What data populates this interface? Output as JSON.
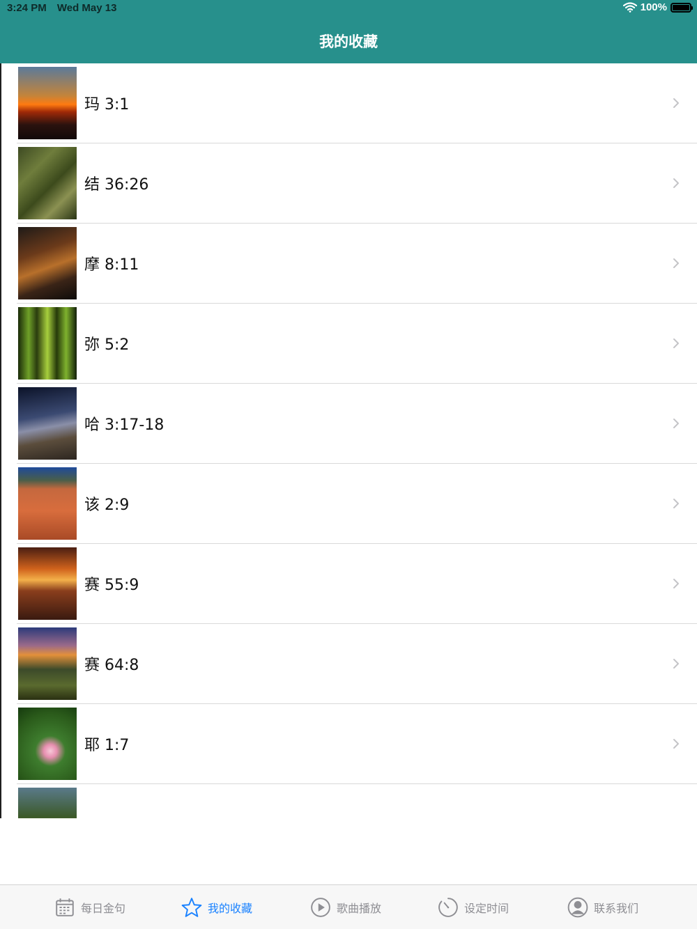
{
  "status_bar": {
    "time": "3:24 PM",
    "date": "Wed May 13",
    "battery": "100%"
  },
  "nav": {
    "title": "我的收藏"
  },
  "favorites": [
    {
      "label": "玛 3:1",
      "image": "sunset-over-clouds"
    },
    {
      "label": "结 36:26",
      "image": "mossy-forest-trees"
    },
    {
      "label": "摩 8:11",
      "image": "golden-gate-bridge"
    },
    {
      "label": "弥 5:2",
      "image": "green-bamboo"
    },
    {
      "label": "哈 3:17-18",
      "image": "milky-way-night-sky"
    },
    {
      "label": "该 2:9",
      "image": "red-sand-dunes"
    },
    {
      "label": "赛 55:9",
      "image": "sunset-over-sea"
    },
    {
      "label": "赛 64:8",
      "image": "wildflowers-at-dusk"
    },
    {
      "label": "耶 1:7",
      "image": "pink-lotus-flower"
    },
    {
      "label": "",
      "image": "green-hills"
    }
  ],
  "tabbar": {
    "tabs": [
      {
        "label": "每日金句",
        "icon": "calendar-icon",
        "active": false
      },
      {
        "label": "我的收藏",
        "icon": "star-icon",
        "active": true
      },
      {
        "label": "歌曲播放",
        "icon": "play-icon",
        "active": false
      },
      {
        "label": "设定时间",
        "icon": "timer-icon",
        "active": false
      },
      {
        "label": "联系我们",
        "icon": "person-icon",
        "active": false
      }
    ]
  },
  "colors": {
    "header": "#27908c",
    "active_tab": "#1a82ff",
    "inactive_tab": "#8e8e93"
  }
}
